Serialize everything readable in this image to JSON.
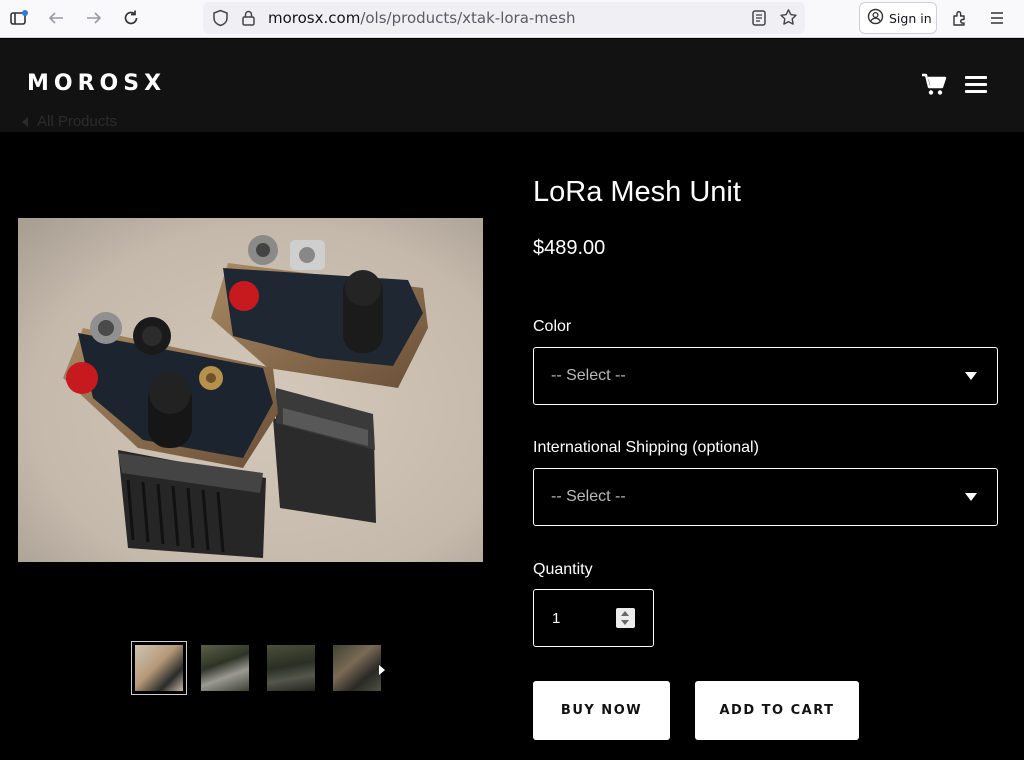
{
  "browser": {
    "url_host": "morosx.com",
    "url_path": "/ols/products/xtak-lora-mesh",
    "signin_label": "Sign in"
  },
  "header": {
    "logo": "MOROSX",
    "back_link": "All Products"
  },
  "product": {
    "title": "LoRa Mesh Unit",
    "price": "$489.00",
    "color_label": "Color",
    "color_value": "-- Select --",
    "shipping_label": "International Shipping (optional)",
    "shipping_value": "-- Select --",
    "quantity_label": "Quantity",
    "quantity_value": "1",
    "buy_now_label": "BUY NOW",
    "add_to_cart_label": "ADD TO CART"
  },
  "gallery": {
    "thumbnail_count": 4,
    "active_thumbnail": 1
  },
  "colors": {
    "page_bg": "#000000",
    "header_bg": "#121212",
    "button_bg": "#ffffff",
    "button_text": "#111111"
  },
  "icons": [
    "sidebar-toggle-icon",
    "back-arrow-icon",
    "forward-arrow-icon",
    "reload-icon",
    "shield-icon",
    "lock-icon",
    "reader-view-icon",
    "bookmark-star-icon",
    "account-icon",
    "extensions-icon",
    "app-menu-icon",
    "cart-icon",
    "hamburger-menu-icon",
    "chevron-left-icon",
    "chevron-right-icon",
    "dropdown-caret-icon"
  ]
}
